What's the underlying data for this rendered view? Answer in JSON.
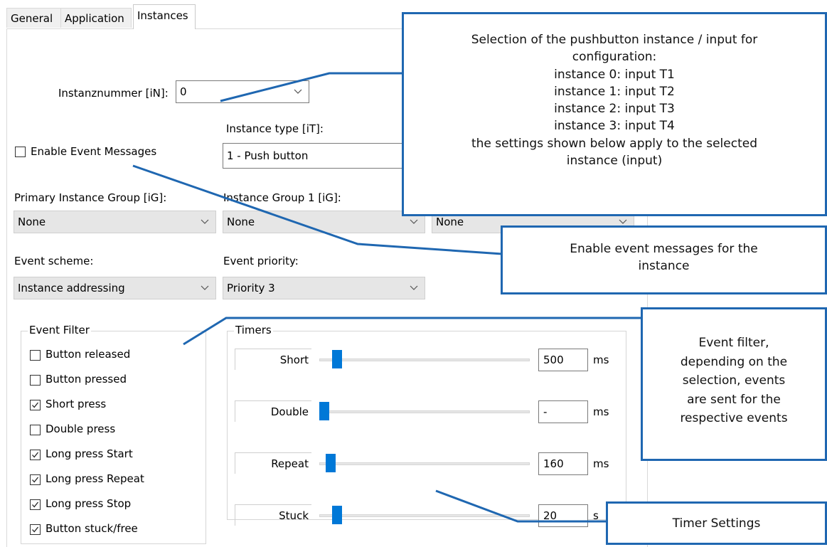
{
  "tabs": [
    {
      "label": "General"
    },
    {
      "label": "Application"
    },
    {
      "label": "Instances"
    }
  ],
  "instance": {
    "label": "Instanznummer [iN]:",
    "value": "0"
  },
  "instance_type": {
    "label": "Instance type [iT]:",
    "value": "1 - Push button"
  },
  "enable_events": {
    "label": "Enable Event Messages",
    "checked": false
  },
  "groups": {
    "primary_label": "Primary Instance Group [iG]:",
    "primary_value": "None",
    "group1_label": "Instance Group 1 [iG]:",
    "group1_value": "None",
    "group2_value": "None"
  },
  "event_scheme": {
    "label": "Event scheme:",
    "value": "Instance addressing"
  },
  "event_priority": {
    "label": "Event priority:",
    "value": "Priority 3"
  },
  "event_filter": {
    "title": "Event Filter",
    "items": [
      {
        "label": "Button released",
        "checked": false
      },
      {
        "label": "Button pressed",
        "checked": false
      },
      {
        "label": "Short press",
        "checked": true
      },
      {
        "label": "Double press",
        "checked": false
      },
      {
        "label": "Long press Start",
        "checked": true
      },
      {
        "label": "Long press Repeat",
        "checked": true
      },
      {
        "label": "Long press Stop",
        "checked": true
      },
      {
        "label": "Button stuck/free",
        "checked": true
      }
    ]
  },
  "timers": {
    "title": "Timers",
    "items": [
      {
        "label": "Short",
        "value": "500",
        "unit": "ms",
        "level": 0.06
      },
      {
        "label": "Double",
        "value": "-",
        "unit": "ms",
        "level": 0.0
      },
      {
        "label": "Repeat",
        "value": "160",
        "unit": "ms",
        "level": 0.03
      },
      {
        "label": "Stuck",
        "value": "20",
        "unit": "s",
        "level": 0.06
      }
    ]
  },
  "callouts": {
    "instance_selection": [
      "Selection of the pushbutton instance / input for",
      "configuration:",
      "instance 0: input T1",
      "instance 1: input T2",
      "instance 2: input T3",
      "instance 3: input T4",
      "the settings shown below apply to the selected",
      "instance (input)"
    ],
    "enable_events": [
      "Enable event messages for the",
      "instance"
    ],
    "event_filter": [
      "Event filter,",
      "depending on the",
      "selection, events",
      "are sent for the",
      "respective events"
    ],
    "timer_settings": [
      "Timer Settings"
    ]
  },
  "colors": {
    "accent": "#0078d7",
    "callout_border": "#1f67b1"
  }
}
